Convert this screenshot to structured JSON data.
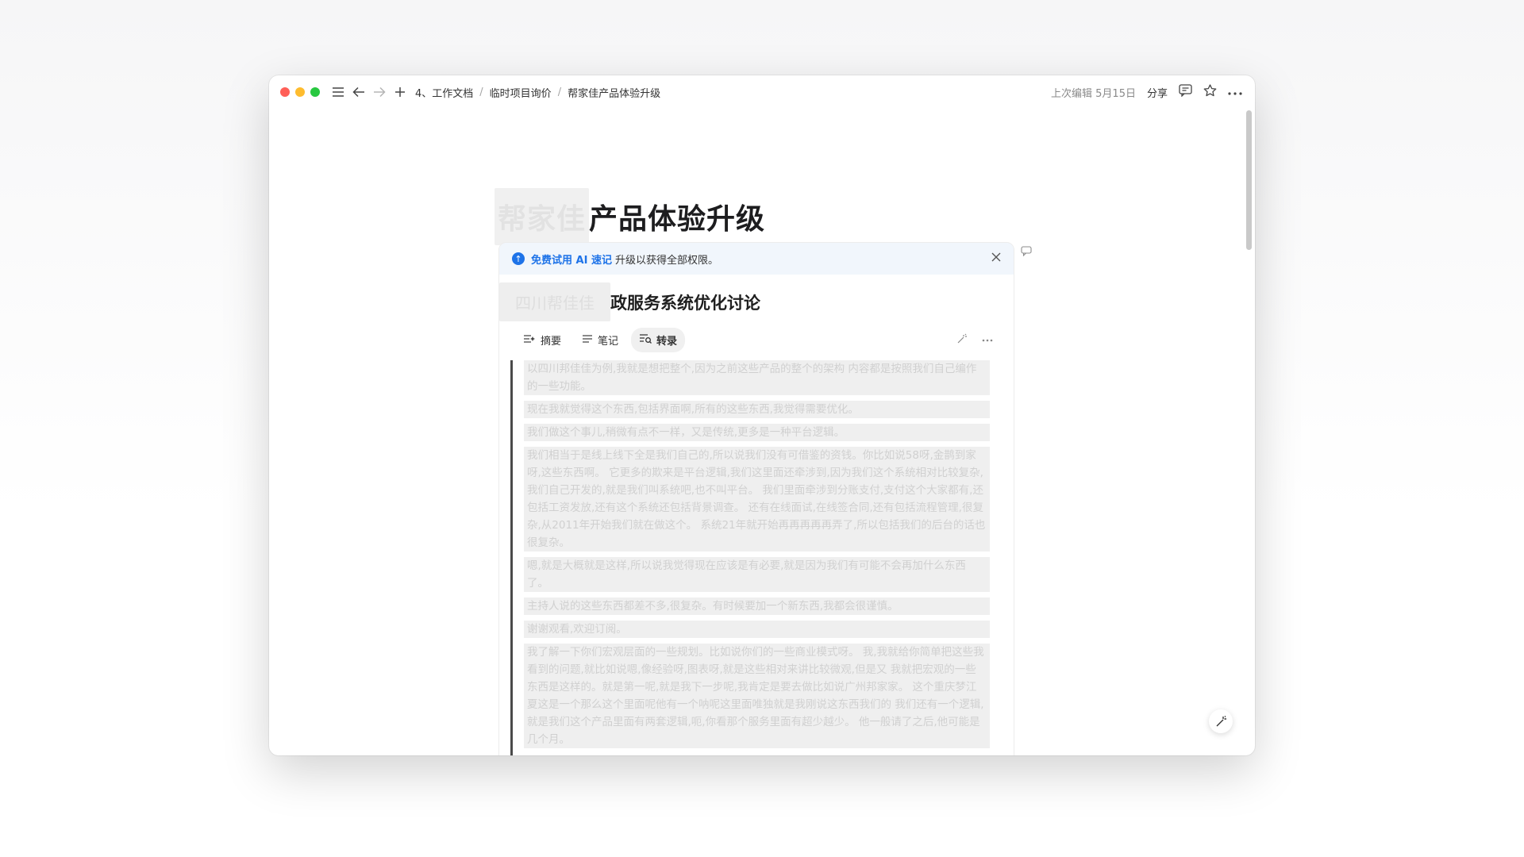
{
  "breadcrumb": {
    "items": [
      "4、工作文档",
      "临时项目询价",
      "帮家佳产品体验升级"
    ]
  },
  "toolbar": {
    "last_edit": "上次编辑 5月15日",
    "share_label": "分享"
  },
  "doc": {
    "title_redacted": "帮家佳",
    "title_visible": "产品体验升级"
  },
  "banner": {
    "link_text": "免费试用 AI 速记",
    "text": "升级以获得全部权限。"
  },
  "meeting": {
    "title_redacted": "四川帮佳佳",
    "title_visible": "政服务系统优化讨论"
  },
  "tabs": [
    {
      "label": "摘要"
    },
    {
      "label": "笔记"
    },
    {
      "label": "转录"
    }
  ],
  "transcript": [
    "以四川邦佳佳为例,我就是想把整个,因为之前这些产品的整个的架构 内容都是按照我们自己编作的一些功能。",
    "现在我就觉得这个东西,包括界面啊,所有的这些东西,我觉得需要优化。",
    "我们做这个事儿,稍微有点不一样，又是传统,更多是一种平台逻辑。",
    "我们相当于是线上线下全是我们自己的,所以说我们没有可借鉴的资钱。你比如说58呀,金鹊到家呀,这些东西啊。 它更多的欺来是平台逻辑,我们这里面还牵涉到,因为我们这个系统相对比较复杂,我们自己开发的,就是我们叫系统吧,也不叫平台。 我们里面牵涉到分账支付,支付这个大家都有,还包括工资发放,还有这个系统还包括背景调查。 还有在线面试,在线签合同,还有包括流程管理,很复杂,从2011年开始我们就在做这个。 系统21年就开始再再再再再弄了,所以包括我们的后台的话也很复杂。",
    "嗯,就是大概就是这样,所以说我觉得现在应该是有必要,就是因为我们有可能不会再加什么东西了。",
    "主持人说的这些东西都差不多,很复杂。有时候要加一个新东西,我都会很谨慎。",
    "谢谢观看,欢迎订阅。",
    "我了解一下你们宏观层面的一些规划。比如说你们的一些商业模式呀。 我,我就给你简单把这些我看到的问题,就比如说嗯,像经验呀,图表呀,就是这些相对来讲比较微观,但是又 我就把宏观的一些东西是这样的。就是第一呢,就是我下一步呢,我肯定是要去做比如说广州邦家家。 这个重庆梦江夏这是一个那么这个里面呢他有一个呐呢这里面唯独就是我刚说这东西我们的 我们还有一个逻辑,就是我们这个产品里面有两套逻辑,呃,你看那个服务里面有超少越少。 他一般请了之后,他可能是几个月。"
  ]
}
